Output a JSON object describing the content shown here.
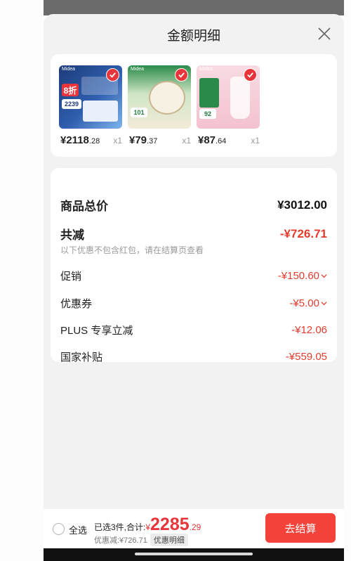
{
  "sheet": {
    "title": "金额明细",
    "close_icon": "close-icon"
  },
  "products": [
    {
      "name": "air-conditioner",
      "price_int": "¥2118",
      "price_dec": ".28",
      "qty": "x1",
      "selected": true,
      "image_colors": [
        "#1d3b7a",
        "#3b7fd4"
      ],
      "image_texts": {
        "brand": "Midea",
        "badge": "8折",
        "price": "2239"
      }
    },
    {
      "name": "rice-cooker",
      "price_int": "¥79",
      "price_dec": ".37",
      "qty": "x1",
      "selected": true,
      "image_colors": [
        "#1f7a3f",
        "#f1e6cf"
      ],
      "image_texts": {
        "brand": "Midea",
        "badge": "",
        "price": "101"
      }
    },
    {
      "name": "blender",
      "price_int": "¥87",
      "price_dec": ".64",
      "qty": "x1",
      "selected": true,
      "image_colors": [
        "#1f7a3f",
        "#f6c9d4"
      ],
      "image_texts": {
        "brand": "Midea",
        "badge": "",
        "price": "92"
      }
    }
  ],
  "details": {
    "total_label": "商品总价",
    "total_value": "¥3012.00",
    "reduce_label": "共减",
    "reduce_value": "-¥726.71",
    "note": "以下优惠不包含红包，请在结算页查看",
    "items": [
      {
        "label": "促销",
        "value": "-¥150.60",
        "expandable": true
      },
      {
        "label": "优惠券",
        "value": "-¥5.00",
        "expandable": true
      },
      {
        "label": "PLUS 专享立减",
        "value": "-¥12.06",
        "expandable": false
      },
      {
        "label": "国家补贴",
        "value": "-¥559.05",
        "expandable": false
      }
    ]
  },
  "bottom": {
    "select_all": "全选",
    "selected_text": "已选3件,合计:",
    "currency": "¥",
    "sum_int": "2285",
    "sum_dec": ".29",
    "discount_text": "优惠减:¥726.71",
    "detail_tag": "优惠明细",
    "checkout": "去结算"
  },
  "colors": {
    "accent_red": "#e8353b",
    "checkout_bg": "#f2423a",
    "sheet_bg": "#f2f2f2"
  }
}
